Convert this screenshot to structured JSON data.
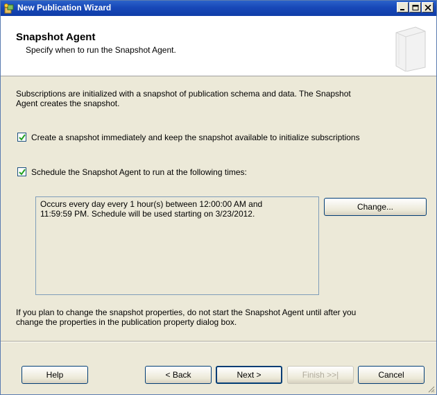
{
  "window": {
    "title": "New Publication Wizard"
  },
  "header": {
    "title": "Snapshot Agent",
    "subtitle": "Specify when to run the Snapshot Agent."
  },
  "intro": {
    "line1": "Subscriptions are initialized with a snapshot of publication schema and data. The Snapshot",
    "line2": "Agent creates the snapshot."
  },
  "options": {
    "create_now": {
      "checked": true,
      "label": "Create a snapshot immediately and keep the snapshot available to initialize subscriptions"
    },
    "schedule": {
      "checked": true,
      "label": "Schedule the Snapshot Agent to run at the following times:"
    }
  },
  "schedule_box": {
    "line1": "Occurs every day every 1 hour(s) between 12:00:00 AM and",
    "line2": "11:59:59 PM. Schedule will be used starting on 3/23/2012."
  },
  "change_button": "Change...",
  "note": {
    "line1": "If you plan to change the snapshot properties, do not start the Snapshot Agent until after you",
    "line2": "change the properties in the publication property dialog box."
  },
  "footer": {
    "help": "Help",
    "back": "< Back",
    "next": "Next >",
    "finish": "Finish >>|",
    "cancel": "Cancel"
  },
  "icons": {
    "title": "wizard-app-icon",
    "header_art": "publication-book-icon",
    "checkmark": "checkmark-icon"
  }
}
